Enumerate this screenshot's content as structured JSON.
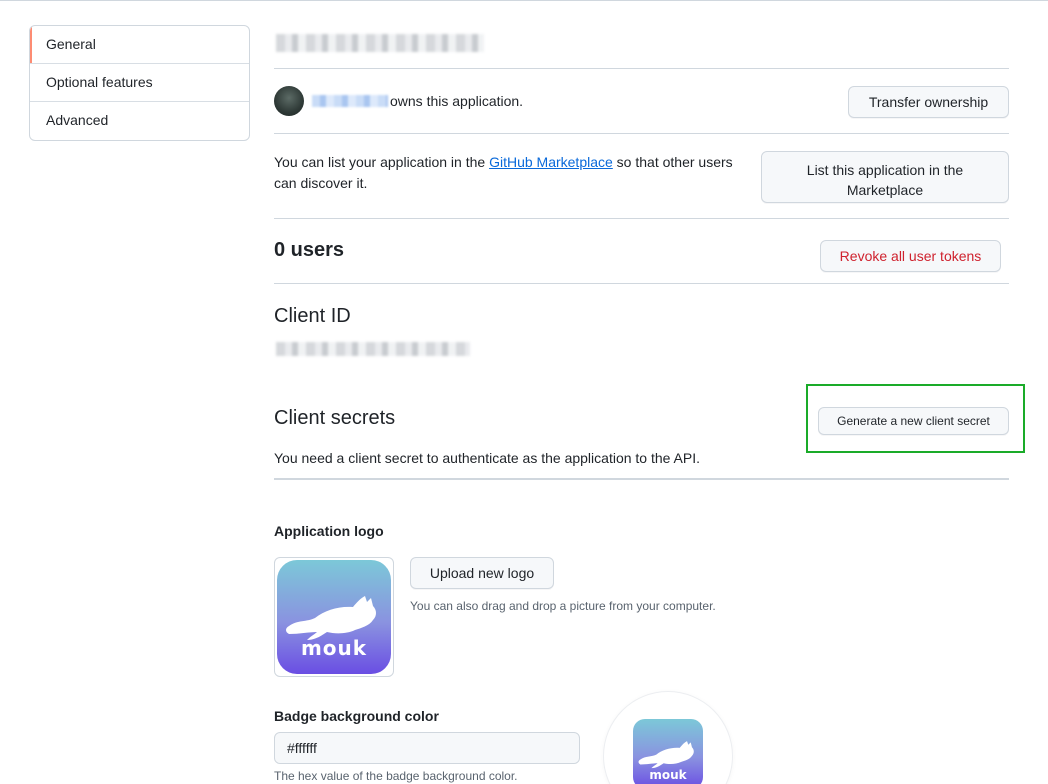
{
  "sidebar": {
    "items": [
      {
        "label": "General",
        "active": true
      },
      {
        "label": "Optional features",
        "active": false
      },
      {
        "label": "Advanced",
        "active": false
      }
    ]
  },
  "owner": {
    "text": "owns this application.",
    "transfer_label": "Transfer ownership"
  },
  "marketplace": {
    "text_before": "You can list your application in the ",
    "link_text": "GitHub Marketplace",
    "text_after": " so that other users can discover it.",
    "button_line1": "List this application in the",
    "button_line2": "Marketplace"
  },
  "users": {
    "count": "0",
    "label": " users",
    "revoke_label": "Revoke all user tokens"
  },
  "client_id": {
    "heading": "Client ID"
  },
  "client_secrets": {
    "heading": "Client secrets",
    "generate_label": "Generate a new client secret",
    "description": "You need a client secret to authenticate as the application to the API."
  },
  "logo": {
    "heading": "Application logo",
    "upload_label": "Upload new logo",
    "hint": "You can also drag and drop a picture from your computer.",
    "brand_word": "mouk"
  },
  "badge": {
    "heading": "Badge background color",
    "value": "#ffffff",
    "hint": "The hex value of the badge background color."
  },
  "colors": {
    "accent_active": "#fd8c73",
    "link": "#0969da",
    "danger": "#cf222e",
    "highlight": "#1aab29",
    "logo_top": "#7cc8d8",
    "logo_bottom": "#6a4ee3"
  }
}
